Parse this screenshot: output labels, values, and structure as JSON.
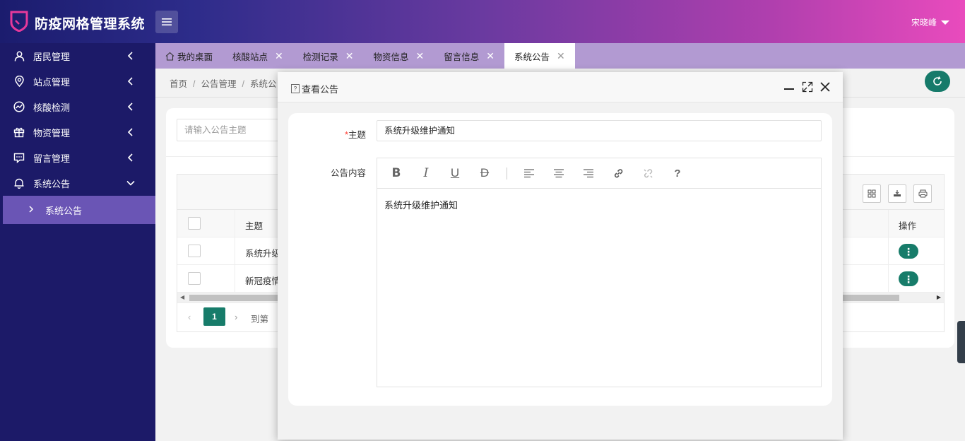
{
  "app": {
    "title": "防疫网格管理系统",
    "user": "宋晓峰"
  },
  "sidebar": {
    "items": [
      {
        "label": "居民管理",
        "icon": "user-icon"
      },
      {
        "label": "站点管理",
        "icon": "location-pin-icon"
      },
      {
        "label": "核酸检测",
        "icon": "chart-line-icon"
      },
      {
        "label": "物资管理",
        "icon": "gift-icon"
      },
      {
        "label": "留言管理",
        "icon": "message-icon"
      },
      {
        "label": "系统公告",
        "icon": "bell-icon"
      }
    ],
    "sub_item": "系统公告"
  },
  "tabs": [
    {
      "label": "我的桌面"
    },
    {
      "label": "核酸站点"
    },
    {
      "label": "检测记录"
    },
    {
      "label": "物资信息"
    },
    {
      "label": "留言信息"
    },
    {
      "label": "系统公告"
    }
  ],
  "breadcrumb": {
    "home": "首页",
    "section": "公告管理",
    "page": "系统公"
  },
  "search": {
    "placeholder": "请输入公告主题"
  },
  "table": {
    "header_title": "主题",
    "header_op": "操作",
    "rows": [
      {
        "title": "系统升级"
      },
      {
        "title": "新冠疫情"
      }
    ]
  },
  "pager": {
    "current": "1",
    "goto": "到第"
  },
  "dialog": {
    "title": "查看公告",
    "subject_label": "主题",
    "subject_value": "系统升级维护通知",
    "content_label": "公告内容",
    "content_value": "系统升级维护通知",
    "help_glyph": "?"
  },
  "colors": {
    "sidebar": "#1c1a68",
    "tabs": "#b29ad2",
    "accent": "#177c6a",
    "active_sub": "#6a55b5"
  }
}
